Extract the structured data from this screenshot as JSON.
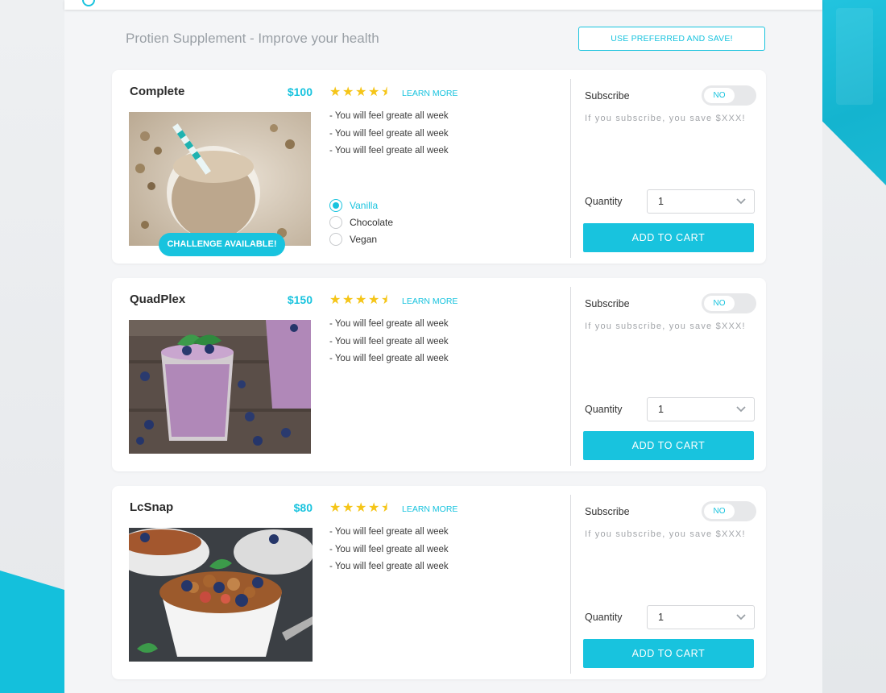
{
  "page": {
    "title": "Protien Supplement - Improve your health",
    "preferred_button": "USE PREFERRED AND SAVE!"
  },
  "colors": {
    "accent": "#18c3de",
    "star": "#f5c518",
    "background": "#f4f5f7"
  },
  "labels": {
    "learn_more": "LEARN MORE",
    "subscribe": "Subscribe",
    "toggle": "NO",
    "save_note": "If you subscribe, you save $XXX!",
    "quantity": "Quantity",
    "add_to_cart": "ADD TO CART",
    "challenge": "CHALLENGE AVAILABLE!"
  },
  "products": [
    {
      "name": "Complete",
      "price": "$100",
      "rating": 4.5,
      "features": [
        "- You will feel greate all week",
        "- You will feel greate all week",
        "- You will feel greate all week"
      ],
      "flavors": [
        {
          "label": "Vanilla",
          "selected": true
        },
        {
          "label": "Chocolate",
          "selected": false
        },
        {
          "label": "Vegan",
          "selected": false
        }
      ],
      "subscribed": false,
      "quantity": "1",
      "image_icon": "shake-jar-icon"
    },
    {
      "name": "QuadPlex",
      "price": "$150",
      "rating": 4.5,
      "features": [
        "- You will feel greate all week",
        "- You will feel greate all week",
        "- You will feel greate all week"
      ],
      "subscribed": false,
      "quantity": "1",
      "image_icon": "blueberry-smoothie-icon"
    },
    {
      "name": "LcSnap",
      "price": "$80",
      "rating": 4.5,
      "features": [
        "- You will feel greate all week",
        "- You will feel greate all week",
        "- You will feel greate all week"
      ],
      "subscribed": false,
      "quantity": "1",
      "image_icon": "granola-bowl-icon"
    }
  ]
}
